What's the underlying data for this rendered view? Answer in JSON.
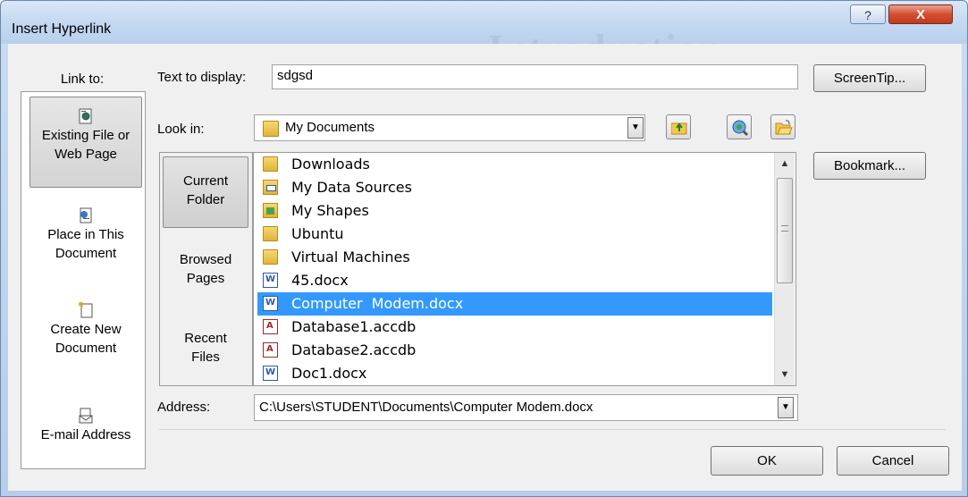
{
  "window": {
    "title": "Insert Hyperlink",
    "background_text": "Introduction",
    "help_button": "?",
    "close_button": "X"
  },
  "link_to": {
    "label": "Link to:",
    "items": [
      {
        "line1": "Existing File or",
        "line2": "Web Page",
        "icon": "existing-file-icon",
        "selected": true
      },
      {
        "line1": "Place in This",
        "line2": "Document",
        "icon": "place-in-document-icon",
        "selected": false
      },
      {
        "line1": "Create New",
        "line2": "Document",
        "icon": "create-new-document-icon",
        "selected": false
      },
      {
        "line1": "E-mail Address",
        "line2": "",
        "icon": "email-address-icon",
        "selected": false
      }
    ]
  },
  "text_to_display": {
    "label": "Text to display:",
    "value": "sdgsd"
  },
  "screentip_button": "ScreenTip...",
  "bookmark_button": "Bookmark...",
  "look_in": {
    "label": "Look in:",
    "value": "My Documents",
    "icon": "folder-icon"
  },
  "toolbar": {
    "up_folder": "up-one-folder-icon",
    "browse_web": "browse-web-icon",
    "browse_file": "browse-file-icon"
  },
  "places": [
    {
      "line1": "Current",
      "line2": "Folder",
      "selected": true
    },
    {
      "line1": "Browsed",
      "line2": "Pages",
      "selected": false
    },
    {
      "line1": "Recent",
      "line2": "Files",
      "selected": false
    }
  ],
  "files": [
    {
      "name": "Downloads",
      "type": "folder",
      "selected": false
    },
    {
      "name": "My Data Sources",
      "type": "data-sources",
      "selected": false
    },
    {
      "name": "My Shapes",
      "type": "shapes",
      "selected": false
    },
    {
      "name": "Ubuntu",
      "type": "folder",
      "selected": false
    },
    {
      "name": "Virtual Machines",
      "type": "folder",
      "selected": false
    },
    {
      "name": "45.docx",
      "type": "docx",
      "selected": false
    },
    {
      "name": "Computer  Modem.docx",
      "type": "docx",
      "selected": true
    },
    {
      "name": "Database1.accdb",
      "type": "accdb",
      "selected": false
    },
    {
      "name": "Database2.accdb",
      "type": "accdb",
      "selected": false
    },
    {
      "name": "Doc1.docx",
      "type": "docx",
      "selected": false
    }
  ],
  "address": {
    "label": "Address:",
    "value": "C:\\Users\\STUDENT\\Documents\\Computer  Modem.docx"
  },
  "ok_button": "OK",
  "cancel_button": "Cancel"
}
